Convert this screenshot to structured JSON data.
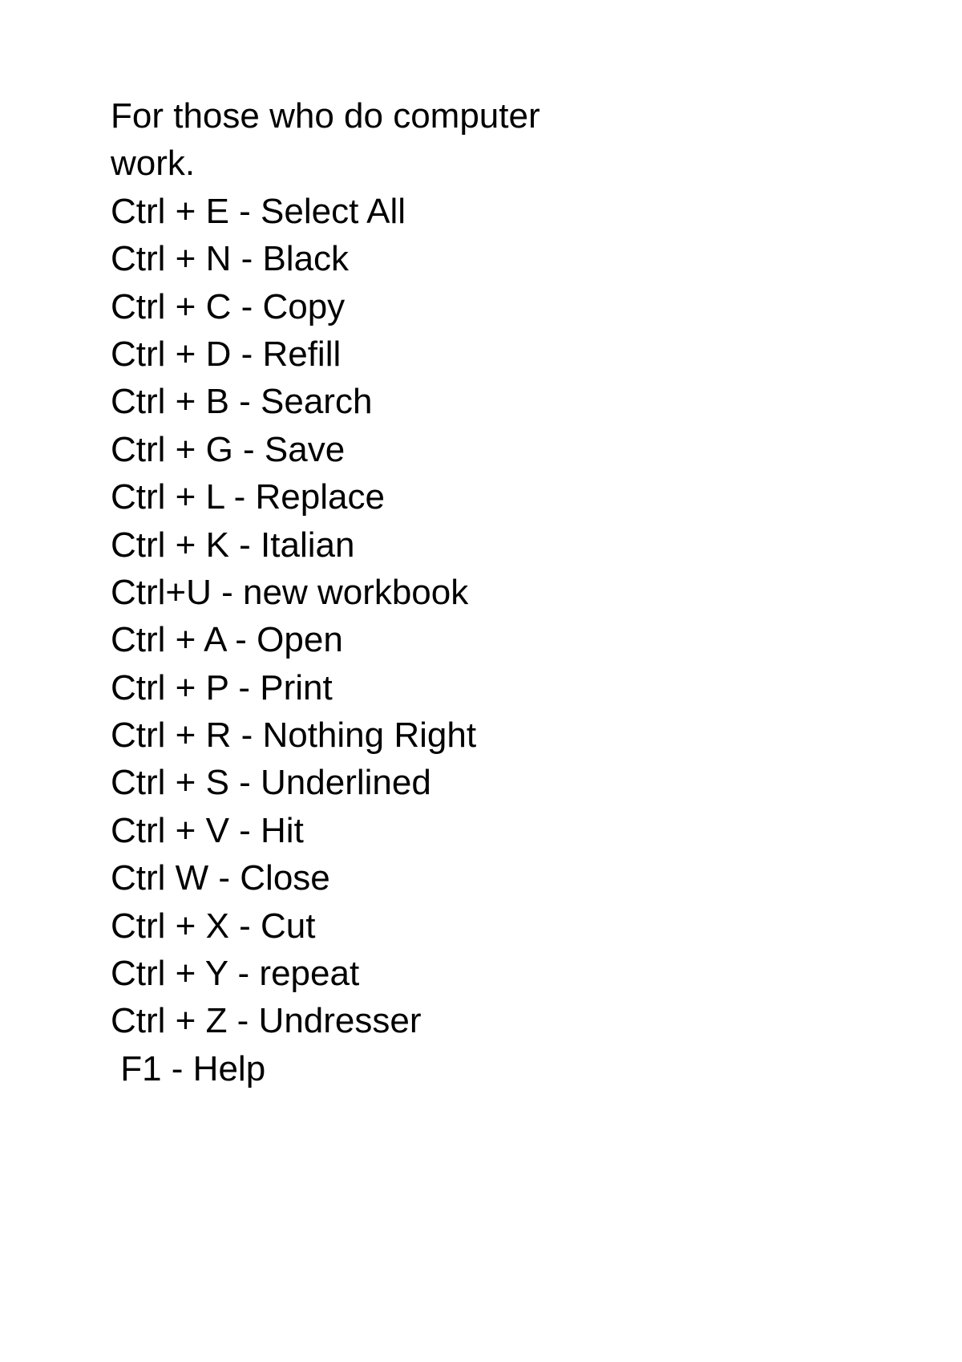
{
  "heading_line1": "For those who do computer",
  "heading_line2": "work.",
  "shortcuts": [
    "Ctrl + E - Select All",
    "Ctrl + N - Black",
    "Ctrl + C - Copy",
    "Ctrl + D - Refill",
    "Ctrl + B - Search",
    "Ctrl + G - Save",
    "Ctrl + L - Replace",
    "Ctrl + K - Italian",
    "Ctrl+U - new workbook",
    "Ctrl + A - Open",
    "Ctrl + P - Print",
    "Ctrl + R - Nothing Right",
    "Ctrl + S - Underlined",
    "Ctrl + V - Hit",
    "Ctrl W - Close",
    "Ctrl + X - Cut",
    "Ctrl + Y - repeat",
    "Ctrl + Z - Undresser"
  ],
  "final_line": " F1 - Help"
}
